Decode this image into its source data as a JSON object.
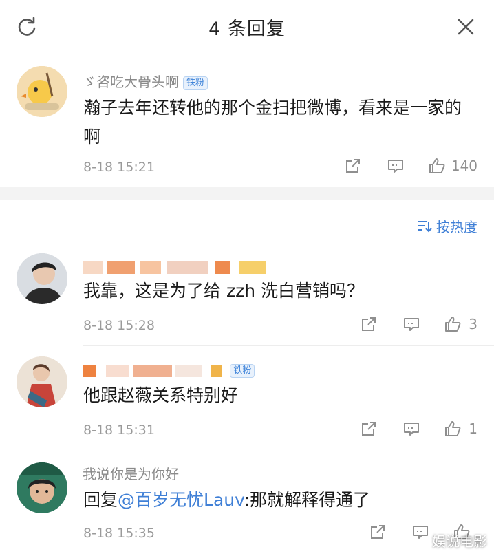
{
  "header": {
    "title": "4 条回复"
  },
  "main_comment": {
    "name": "ゞ咨吃大骨头啊",
    "badge": "铁粉",
    "text": "瀚子去年还转他的那个金扫把微博，看来是一家的啊",
    "time": "8-18 15:21",
    "likes": "140"
  },
  "sort": {
    "label": "按热度"
  },
  "replies": [
    {
      "name": "",
      "badge": "",
      "text": "我靠，这是为了给 zzh 洗白营销吗？",
      "time": "8-18 15:28",
      "likes": "3"
    },
    {
      "name": "",
      "badge": "铁粉",
      "text": "他跟赵薇关系特别好",
      "time": "8-18 15:31",
      "likes": "1"
    },
    {
      "name": "我说你是为你好",
      "badge": "",
      "text_prefix": "回复",
      "mention": "@百岁无忧Lauv",
      "text_suffix": ":那就解释得通了",
      "time": "8-18 15:35",
      "likes": ""
    }
  ],
  "watermark": "娱说电影"
}
